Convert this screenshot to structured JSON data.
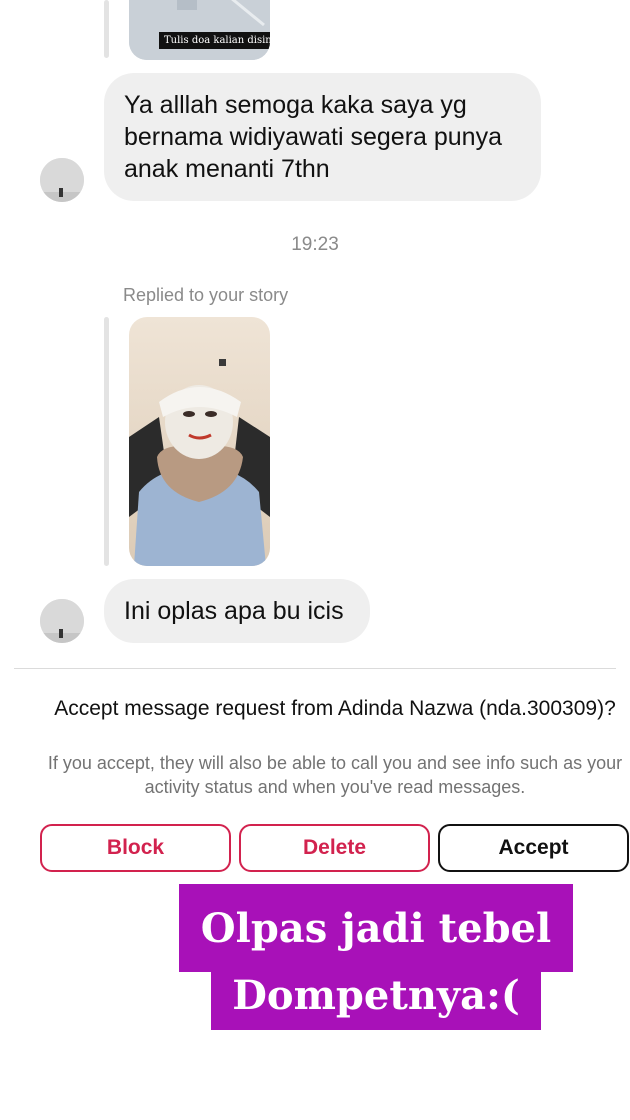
{
  "messages": [
    {
      "type": "story_reply",
      "story_caption": "Tulis doa kalian disini...",
      "text": "Ya alllah semoga kaka saya yg bernama widiyawati segera punya anak menanti 7thn"
    },
    {
      "type": "story_reply",
      "timestamp": "19:23",
      "reply_label": "Replied to your story",
      "text": "Ini oplas apa bu icis"
    }
  ],
  "request": {
    "title": "Accept message request from Adinda Nazwa (nda.300309)?",
    "info": "If you accept, they will also be able to call you and see info such as your activity status and when you've read messages.",
    "block_label": "Block",
    "delete_label": "Delete",
    "accept_label": "Accept"
  },
  "overlay": {
    "line1": "Olpas jadi tebel",
    "line2": "Dompetnya:("
  },
  "colors": {
    "danger": "#d2224e",
    "overlay": "#a811b8",
    "bubble": "#efefef",
    "meta_text": "#8a8a8a"
  }
}
